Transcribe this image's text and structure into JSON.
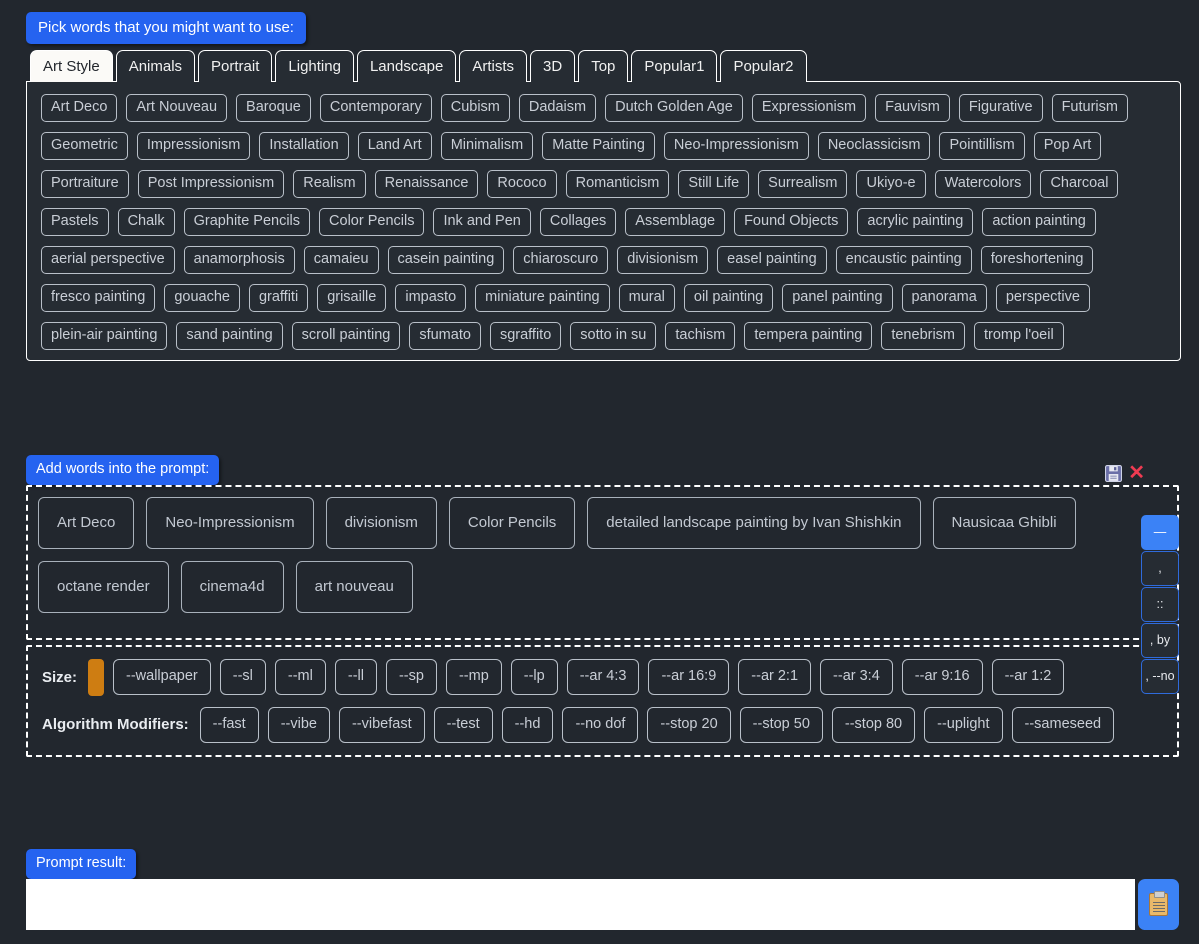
{
  "pick_section": {
    "label": "Pick words that you might want to use:",
    "tabs": [
      {
        "label": "Art Style",
        "active": true
      },
      {
        "label": "Animals",
        "active": false
      },
      {
        "label": "Portrait",
        "active": false
      },
      {
        "label": "Lighting",
        "active": false
      },
      {
        "label": "Landscape",
        "active": false
      },
      {
        "label": "Artists",
        "active": false
      },
      {
        "label": "3D",
        "active": false
      },
      {
        "label": "Top",
        "active": false
      },
      {
        "label": "Popular1",
        "active": false
      },
      {
        "label": "Popular2",
        "active": false
      }
    ],
    "word_rows": [
      [
        "Art Deco",
        "Art Nouveau",
        "Baroque",
        "Contemporary",
        "Cubism",
        "Dadaism",
        "Dutch Golden Age",
        "Expressionism",
        "Fauvism",
        "Figurative",
        "Futurism"
      ],
      [
        "Geometric",
        "Impressionism",
        "Installation",
        "Land Art",
        "Minimalism",
        "Matte Painting",
        "Neo-Impressionism",
        "Neoclassicism",
        "Pointillism",
        "Pop Art"
      ],
      [
        "Portraiture",
        "Post Impressionism",
        "Realism",
        "Renaissance",
        "Rococo",
        "Romanticism",
        "Still Life",
        "Surrealism",
        "Ukiyo-e",
        "Watercolors",
        "Charcoal"
      ],
      [
        "Pastels",
        "Chalk",
        "Graphite Pencils",
        "Color Pencils",
        "Ink and Pen",
        "Collages",
        "Assemblage",
        "Found Objects",
        "acrylic painting",
        "action painting"
      ],
      [
        "aerial perspective",
        "anamorphosis",
        "camaieu",
        "casein painting",
        "chiaroscuro",
        "divisionism",
        "easel painting",
        "encaustic painting",
        "foreshortening"
      ],
      [
        "fresco painting",
        "gouache",
        "graffiti",
        "grisaille",
        "impasto",
        "miniature painting",
        "mural",
        "oil painting",
        "panel painting",
        "panorama",
        "perspective"
      ],
      [
        "plein-air painting",
        "sand painting",
        "scroll painting",
        "sfumato",
        "sgraffito",
        "sotto in su",
        "tachism",
        "tempera painting",
        "tenebrism",
        "tromp l'oeil"
      ]
    ]
  },
  "add_section": {
    "label": "Add words into the prompt:",
    "save_icon": "floppy-disk-save-icon",
    "close_icon": "✕",
    "prompt_words": [
      "Art Deco",
      "Neo-Impressionism",
      "divisionism",
      "Color Pencils",
      "detailed landscape painting by Ivan Shishkin",
      "Nausicaa Ghibli",
      "octane render",
      "cinema4d",
      "art nouveau"
    ],
    "separators": [
      {
        "label": "—",
        "active": true
      },
      {
        "label": ",",
        "active": false
      },
      {
        "label": "::",
        "active": false
      },
      {
        "label": ", by",
        "active": false
      },
      {
        "label": ", --no",
        "active": false
      }
    ]
  },
  "modifiers": {
    "size_label": "Size:",
    "size_swatch_color": "#ce7d12",
    "size_options": [
      "--wallpaper",
      "--sl",
      "--ml",
      "--ll",
      "--sp",
      "--mp",
      "--lp",
      "--ar 4:3",
      "--ar 16:9",
      "--ar 2:1",
      "--ar 3:4",
      "--ar 9:16",
      "--ar 1:2"
    ],
    "algorithm_label": "Algorithm Modifiers:",
    "algorithm_options": [
      "--fast",
      "--vibe",
      "--vibefast",
      "--test",
      "--hd",
      "--no dof",
      "--stop 20",
      "--stop 50",
      "--stop 80",
      "--uplight",
      "--sameseed"
    ]
  },
  "result_section": {
    "label": "Prompt result:",
    "value": "",
    "placeholder": "",
    "copy_icon": "clipboard-icon"
  },
  "colors": {
    "background": "#22272e",
    "panel": "#262c33",
    "accent_blue": "#2563f0",
    "button_blue": "#3b82f6",
    "orange_swatch": "#ce7d12",
    "close_red": "#ef3b52",
    "chip_border": "#b9c0c9",
    "chip_text": "#c9ced6"
  }
}
